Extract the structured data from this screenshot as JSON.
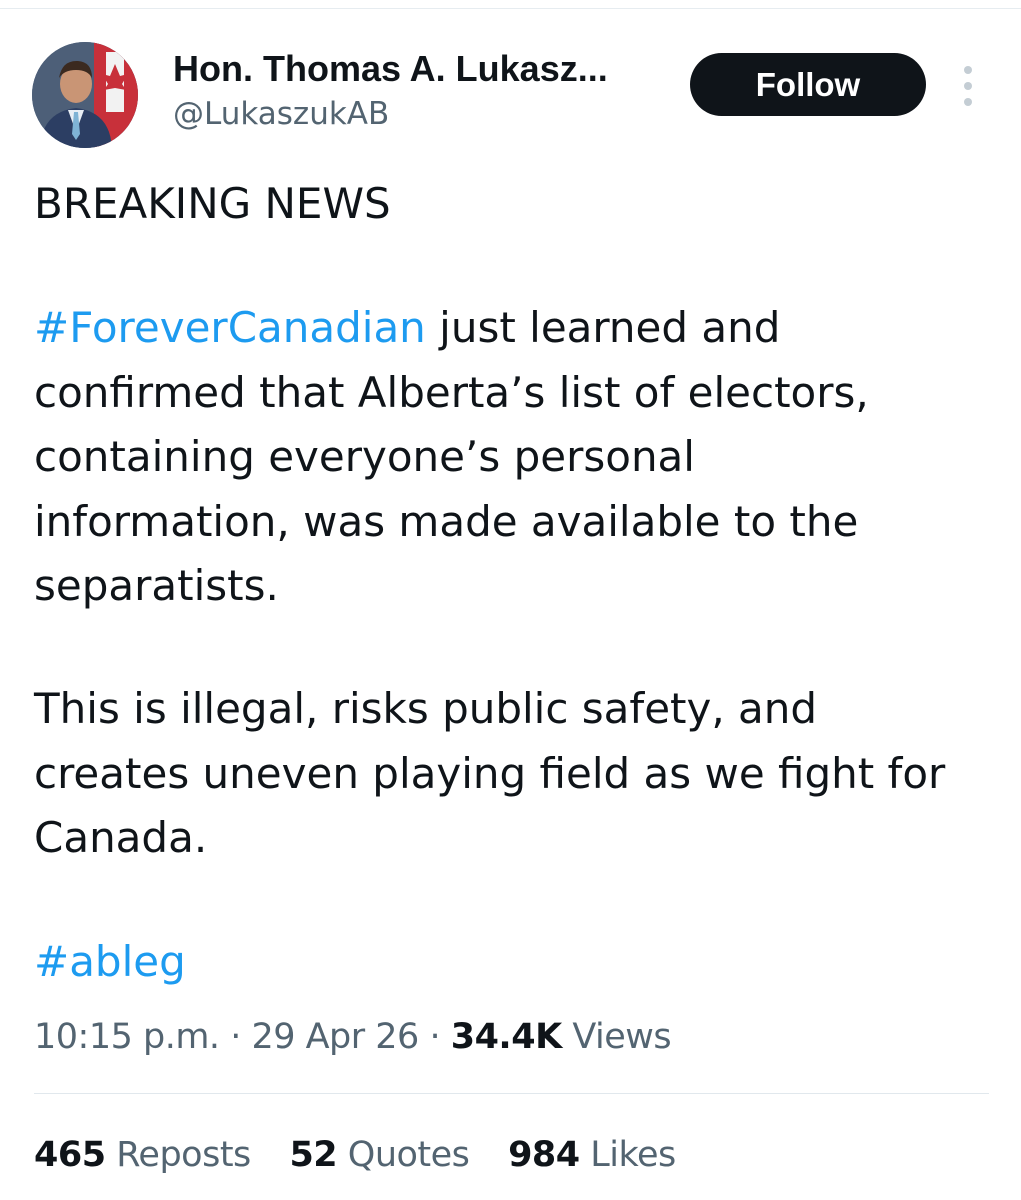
{
  "author": {
    "display_name": "Hon. Thomas A. Lukasz...",
    "handle": "@LukaszukAB"
  },
  "actions": {
    "follow_label": "Follow",
    "more_icon": "more-dots-icon"
  },
  "tweet": {
    "headline": "BREAKING NEWS",
    "hashtag_main": "#ForeverCanadian",
    "paragraph1_lines": [
      " just learned and",
      "confirmed that Alberta’s list of electors,",
      "containing everyone’s personal",
      "information, was made available to the",
      "separatists."
    ],
    "paragraph2_lines": [
      "This is illegal, risks public safety, and",
      "creates uneven playing field as we fight for",
      "Canada."
    ],
    "hashtag_footer": "#ableg"
  },
  "meta": {
    "time": "10:15 p.m.",
    "sep": " · ",
    "date": "29 Apr 26",
    "views_count": "34.4K",
    "views_label": " Views"
  },
  "stats": {
    "reposts_count": "465",
    "reposts_label": " Reposts",
    "quotes_count": "52",
    "quotes_label": " Quotes",
    "likes_count": "984",
    "likes_label": " Likes"
  },
  "colors": {
    "link": "#1d9bf0",
    "text": "#0f1419",
    "secondary": "#536471",
    "button": "#0f1419"
  }
}
